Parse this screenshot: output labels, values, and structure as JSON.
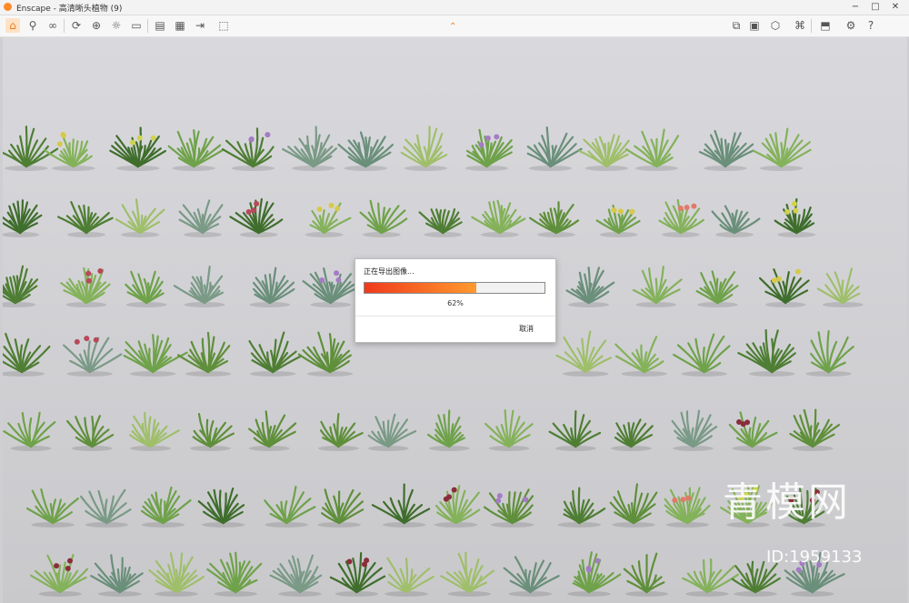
{
  "window": {
    "app_name": "Enscape",
    "title": "Enscape - 高清晰头植物 (9)",
    "controls": {
      "minimize": "−",
      "maximize": "□",
      "close": "✕"
    }
  },
  "toolbar": {
    "left_icons": [
      "home-icon",
      "walk-icon",
      "binoculars-icon",
      "sync-icon",
      "sync-views-icon",
      "light-icon",
      "capture-icon",
      "video-icon",
      "batch-render-icon",
      "export-icon",
      "web-export-icon"
    ],
    "right_icons": [
      "map-icon",
      "monitor-icon",
      "cube-icon",
      "asset-library-icon",
      "material-icon",
      "settings-icon",
      "help-icon"
    ]
  },
  "dialog": {
    "title": "正在导出图像...",
    "percent_text": "62%",
    "progress": 0.62,
    "cancel_label": "取消"
  },
  "watermark": {
    "logo_text": "青模网",
    "id_text": "ID:1959133"
  },
  "colors": {
    "accent": "#f07c1a",
    "progress_start": "#ef3a1c",
    "progress_end": "#ff9a2e"
  }
}
